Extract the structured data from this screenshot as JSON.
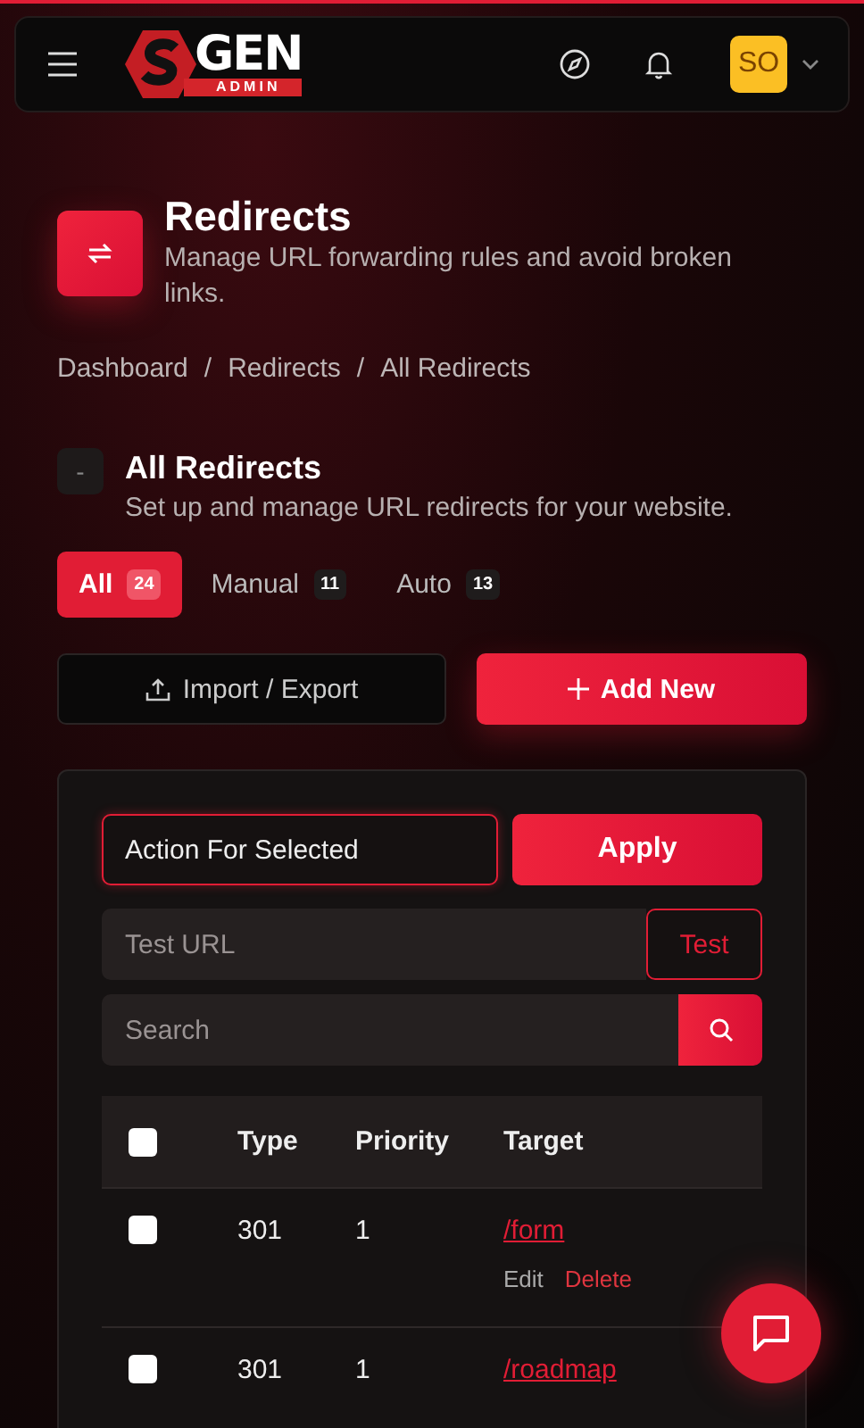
{
  "header": {
    "logo_main": "GEN",
    "logo_sub": "ADMIN",
    "avatar": "SO"
  },
  "page": {
    "title": "Redirects",
    "subtitle": "Manage URL forwarding rules and avoid broken links."
  },
  "breadcrumb": {
    "separator": "/",
    "items": [
      "Dashboard",
      "Redirects",
      "All Redirects"
    ]
  },
  "section": {
    "toggle": "-",
    "title": "All Redirects",
    "description": "Set up and manage URL redirects for your website."
  },
  "tabs": [
    {
      "label": "All",
      "count": "24",
      "selected": true
    },
    {
      "label": "Manual",
      "count": "11",
      "selected": false
    },
    {
      "label": "Auto",
      "count": "13",
      "selected": false
    }
  ],
  "buttons": {
    "import_export": "Import / Export",
    "add_new": "Add New"
  },
  "bulk": {
    "action": "Action For Selected",
    "apply": "Apply"
  },
  "test": {
    "placeholder": "Test URL",
    "button": "Test"
  },
  "search": {
    "placeholder": "Search"
  },
  "table": {
    "select_all_checked": false,
    "columns": [
      "Type",
      "Priority",
      "Target"
    ],
    "rows": [
      {
        "checked": false,
        "type": "301",
        "priority": "1",
        "target": "/form",
        "actions": [
          "Edit",
          "Delete"
        ]
      },
      {
        "checked": false,
        "type": "301",
        "priority": "1",
        "target": "/roadmap"
      }
    ]
  }
}
